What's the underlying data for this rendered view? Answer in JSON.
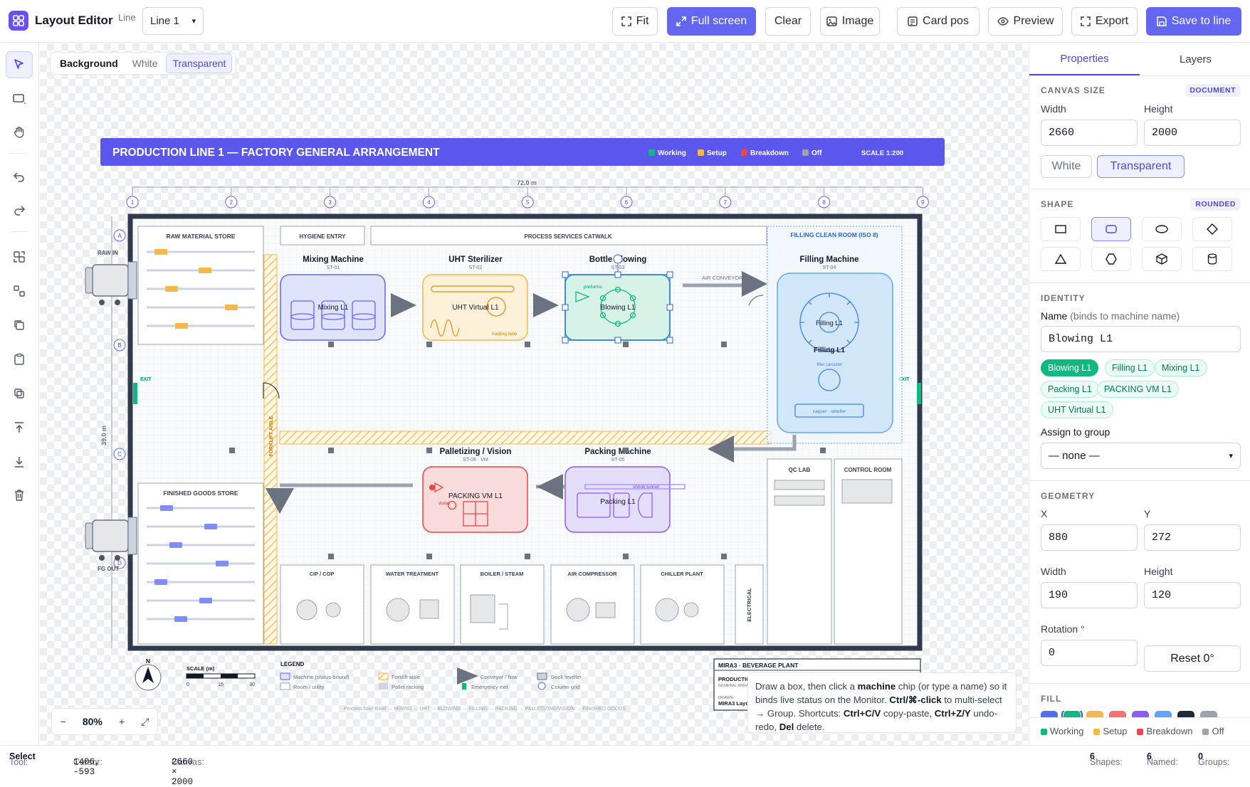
{
  "app": {
    "title": "Layout Editor",
    "line_label": "Line",
    "line_value": "Line 1"
  },
  "toolbar": {
    "fit": "Fit",
    "fullscreen": "Full screen",
    "clear": "Clear",
    "image": "Image",
    "card_pos": "Card pos",
    "preview": "Preview",
    "export": "Export",
    "save": "Save to line"
  },
  "background_toggle": {
    "label": "Background",
    "white": "White",
    "transparent": "Transparent"
  },
  "drawing": {
    "title": "PRODUCTION LINE 1 — FACTORY GENERAL ARRANGEMENT",
    "status_legend": {
      "working": "Working",
      "setup": "Setup",
      "breakdown": "Breakdown",
      "off": "Off"
    },
    "scale": "SCALE 1:200",
    "width_dim": "72.0 m",
    "height_dim": "39.0 m",
    "columns": [
      "1",
      "2",
      "3",
      "4",
      "5",
      "6",
      "7",
      "8",
      "9"
    ],
    "rows": [
      "A",
      "B",
      "C",
      "D"
    ],
    "raw_in": "RAW IN",
    "fg_out": "FG OUT",
    "exit": "EXIT",
    "raw_store": "RAW MATERIAL STORE",
    "hygiene": "HYGIENE ENTRY",
    "catwalk": "PROCESS SERVICES CATWALK",
    "clean_room": "FILLING CLEAN ROOM (ISO 8)",
    "air_conveyor": "AIR CONVEYOR",
    "forklift": "FORKLIFT AISLE",
    "finished_store": "FINISHED GOODS STORE",
    "qc_lab": "QC LAB",
    "control_room": "CONTROL ROOM",
    "utilities": [
      "CIP / COP",
      "WATER TREATMENT",
      "BOILER / STEAM",
      "AIR COMPRESSOR",
      "CHILLER PLANT"
    ],
    "electrical": "ELECTRICAL",
    "machines": {
      "mixing": {
        "title": "Mixing Machine",
        "code": "ST-01",
        "name": "Mixing L1"
      },
      "uht": {
        "title": "UHT Sterilizer",
        "code": "ST-02",
        "name": "UHT Virtual L1",
        "sub": "holding tube"
      },
      "blowing": {
        "title": "Bottle Blowing",
        "code": "ST-03",
        "name": "Blowing L1",
        "sub": "preforms"
      },
      "filling": {
        "title": "Filling Machine",
        "code": "ST-04",
        "name": "Filling L1",
        "caption": "Filling L1",
        "sub1": "filler carousel",
        "sub2": "capper · labeller"
      },
      "packing": {
        "title": "Packing Machine",
        "code": "ST-05",
        "name": "Packing L1",
        "sub": "shrink tunnel"
      },
      "palletizing": {
        "title": "Palletizing / Vision",
        "code": "ST-06 · VM",
        "name": "PACKING VM L1",
        "sub": "vision"
      }
    },
    "north": "N",
    "scale_bar": {
      "label": "SCALE (m)",
      "ticks": [
        "0",
        "15",
        "30"
      ]
    },
    "legend": {
      "title": "LEGEND",
      "items": [
        "Machine (status-bound)",
        "Room / utility",
        "Forklift aisle",
        "Pallet racking",
        "Conveyor / flow",
        "Emergency exit",
        "Dock leveller",
        "Column grid"
      ]
    },
    "process_flow": "Process flow: RAW → MIXING → UHT → BLOWING → FILLING → PACKING → PALLETIZING/VISION → FINISHED GOODS",
    "title_block": {
      "plant": "MIRA3 · BEVERAGE PLANT",
      "r1": "PRODUCTION LINE 1",
      "r1b": "GENERAL ARRANGEMENT",
      "r2": "DRAWN",
      "r3": "MIRA3 Layout Editor"
    }
  },
  "zoom": {
    "minus": "−",
    "value": "80%",
    "plus": "+"
  },
  "tip": {
    "p1": "Draw a box, then click a ",
    "b1": "machine",
    "p2": " chip (or type a name) so it binds live status on the Monitor. ",
    "b2": "Ctrl/⌘-click",
    "p3": " to multi-select → Group. Shortcuts: ",
    "b3": "Ctrl+C/V",
    "p4": " copy-paste, ",
    "b4": "Ctrl+Z/Y",
    "p5": " undo-redo, ",
    "b5": "Del",
    "p6": " delete."
  },
  "panel": {
    "tabs": {
      "properties": "Properties",
      "layers": "Layers"
    },
    "canvas_size": {
      "title": "CANVAS SIZE",
      "badge": "DOCUMENT",
      "width_label": "Width",
      "height_label": "Height",
      "width": "2660",
      "height": "2000",
      "white": "White",
      "transparent": "Transparent"
    },
    "shape": {
      "title": "SHAPE",
      "badge": "ROUNDED"
    },
    "identity": {
      "title": "IDENTITY",
      "name_label": "Name",
      "name_hint": "(binds to machine name)",
      "name_value": "Blowing L1",
      "chips": [
        "Blowing L1",
        "Filling L1",
        "Mixing L1",
        "Packing L1",
        "PACKING VM L1",
        "UHT Virtual L1"
      ],
      "group_label": "Assign to group",
      "group_value": "— none —"
    },
    "geometry": {
      "title": "GEOMETRY",
      "x_label": "X",
      "y_label": "Y",
      "x": "880",
      "y": "272",
      "w_label": "Width",
      "h_label": "Height",
      "w": "190",
      "h": "120",
      "rot_label": "Rotation °",
      "rot": "0",
      "reset": "Reset 0°"
    },
    "fill": {
      "title": "FILL",
      "swatches": [
        "#4f6ee8",
        "#10b981",
        "#f5b84a",
        "#f87171",
        "#8b5cf6",
        "#60a5fa",
        "#1f2937",
        "#9ca3af"
      ]
    },
    "status_legend": {
      "working": "Working",
      "setup": "Setup",
      "breakdown": "Breakdown",
      "off": "Off"
    }
  },
  "status": {
    "tool_label": "Tool:",
    "tool": "Select",
    "cursor_label": "Cursor:",
    "cursor": "1406, -593",
    "canvas_label": "Canvas:",
    "canvas": "2660 × 2000",
    "shapes_label": "Shapes:",
    "shapes": "6",
    "named_label": "Named:",
    "named": "6",
    "groups_label": "Groups:",
    "groups": "0"
  },
  "colors": {
    "accent": "#6366f1",
    "working": "#10b981",
    "setup": "#f5b84a",
    "breakdown": "#ef4444",
    "off": "#9ca3af"
  }
}
